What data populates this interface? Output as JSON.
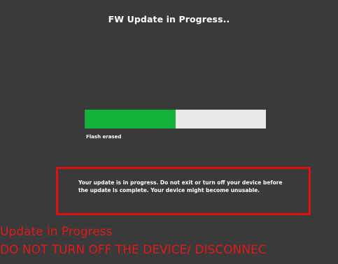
{
  "dialog": {
    "title": "FW Update in Progress..",
    "progress_fraction": 0.5,
    "status_text": "Flash erased",
    "warning_text": "Your update is in progress. Do not exit or turn off your device before the update is complete. Your device might become unusable."
  },
  "annotation": {
    "line1": "Update in Progress",
    "line2": "DO NOT TURN OFF THE DEVICE/ DISCONNEC"
  },
  "colors": {
    "background": "#3a3a3a",
    "progress_fill": "#14b23a",
    "progress_track": "#e8e8e8",
    "warning_border": "#e01010",
    "annotation_text": "#e01a1a"
  }
}
